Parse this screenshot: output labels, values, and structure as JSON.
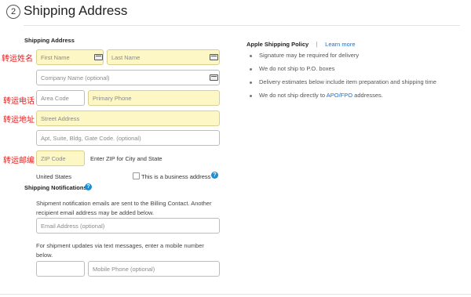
{
  "header": {
    "step": "2",
    "title": "Shipping Address"
  },
  "form": {
    "section_title": "Shipping Address",
    "annotations": {
      "name": "转运姓名",
      "phone": "转运电话",
      "street": "转运地址",
      "zip": "转运邮编"
    },
    "fields": {
      "first_name": "First Name",
      "last_name": "Last Name",
      "company": "Company Name (optional)",
      "area_code": "Area Code",
      "primary_phone": "Primary Phone",
      "street": "Street Address",
      "apt": "Apt, Suite, Bldg, Gate Code. (optional)",
      "zip": "ZIP Code",
      "email": "Email Address (optional)",
      "mobile_area": "",
      "mobile_phone": "Mobile Phone (optional)"
    },
    "zip_hint": "Enter ZIP for City and State",
    "country": "United States",
    "business_checkbox_label": "This is a business address",
    "highlight_color": "#fcf7c4"
  },
  "notifications": {
    "title": "Shipping Notifications",
    "email_text": "Shipment notification emails are sent to the Billing Contact. Another recipient email address may be added below.",
    "sms_text": "For shipment updates via text messages, enter a mobile number below."
  },
  "policy": {
    "title": "Apple Shipping Policy",
    "separator": "|",
    "learn_more": "Learn more",
    "bullets": [
      "Signature may be required for delivery",
      "We do not ship to P.O. boxes",
      "Delivery estimates below include item preparation and shipping time"
    ],
    "last_bullet_prefix": "We do not ship directly to ",
    "last_bullet_link": "APO/FPO",
    "last_bullet_suffix": " addresses."
  },
  "colors": {
    "link": "#1f6fc6",
    "help_icon": "#1a8fd6",
    "annotation": "#e02020"
  }
}
